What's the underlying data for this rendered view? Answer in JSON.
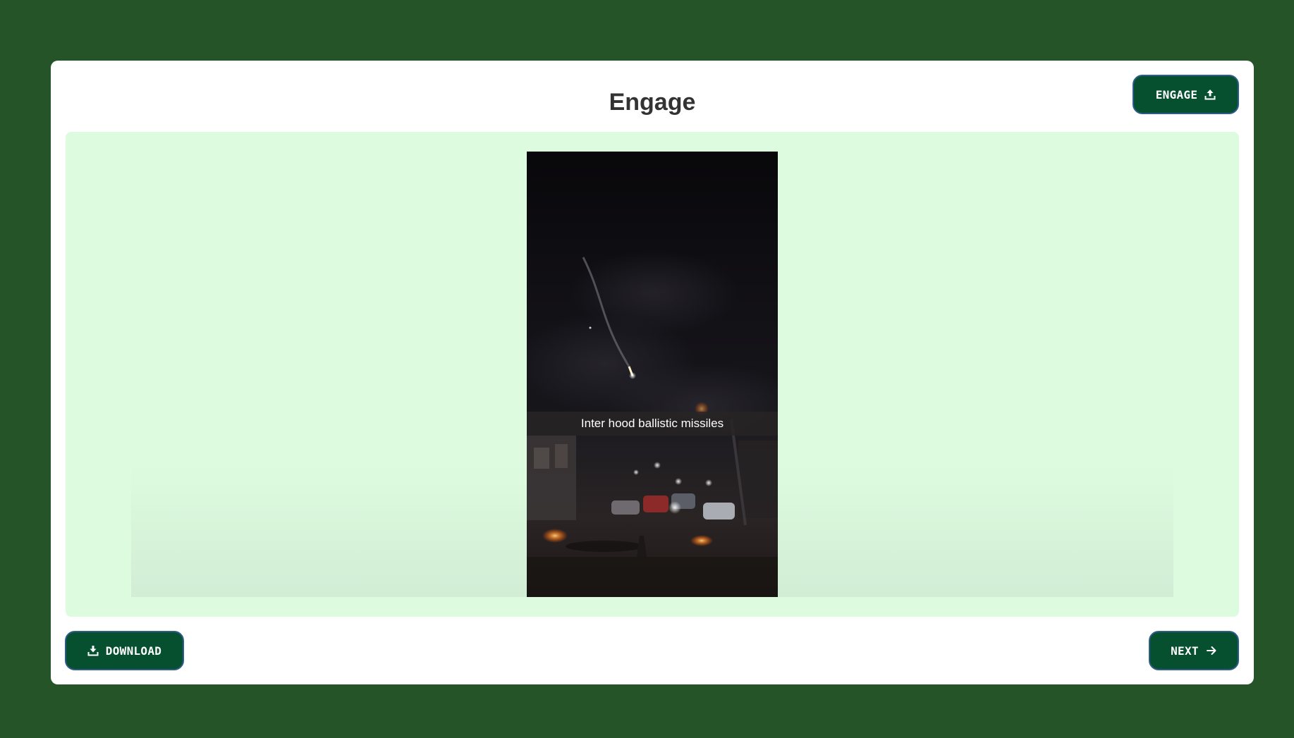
{
  "page": {
    "title": "Engage"
  },
  "buttons": {
    "engage_label": "ENGAGE",
    "download_label": "DOWNLOAD",
    "next_label": "NEXT"
  },
  "video": {
    "caption": "Inter hood ballistic missiles"
  },
  "icons": {
    "engage": "upload-icon",
    "download": "download-icon",
    "next": "arrow-right-icon"
  },
  "colors": {
    "page_background": "#245428",
    "card_background": "#ffffff",
    "stage_background": "#ddfcdf",
    "button_background": "#065030",
    "button_border": "#2e5c8a",
    "title_text": "#333333"
  }
}
